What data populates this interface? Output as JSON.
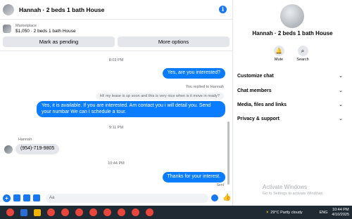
{
  "header": {
    "title": "Hannah · 2 beds 1 bath House"
  },
  "marketplace": {
    "label": "Marketplace",
    "listing": "$1,050 · 2 beds 1 bath House"
  },
  "actions": {
    "pending": "Mark as pending",
    "more": "More options"
  },
  "messages": {
    "time1": "8:03 PM",
    "out1": "Yes, are you interested?",
    "reply_note": "You replied to Hannah",
    "quoted": "Hi! my lease is up soon and this is very nice when is it move in ready?",
    "out2": "Yes, it is available. If you are interested. Am contact you i will detail you. Send your numbar We can I schedule a tour.",
    "time2": "9:11 PM",
    "sender": "Hannah",
    "in1": "(954)-719-9805",
    "time3": "10:44 PM",
    "out3": "Thanks for your interest.",
    "sent": "Sent"
  },
  "composer": {
    "placeholder": "Aa"
  },
  "panel": {
    "name": "Hannah · 2 beds 1 bath House",
    "mute": "Mute",
    "search": "Search",
    "rows": [
      "Customize chat",
      "Chat members",
      "Media, files and links",
      "Privacy & support"
    ]
  },
  "watermark": {
    "line1": "Activate Windows",
    "line2": "Go to Settings to activate Windows."
  },
  "taskbar": {
    "weather": "29°C",
    "condition": "Partly cloudy",
    "lang": "ENG",
    "time": "10:44 PM",
    "date": "4/10/2025"
  },
  "colors": {
    "accent": "#0a7cff",
    "taskbar": "#1f2a33"
  }
}
